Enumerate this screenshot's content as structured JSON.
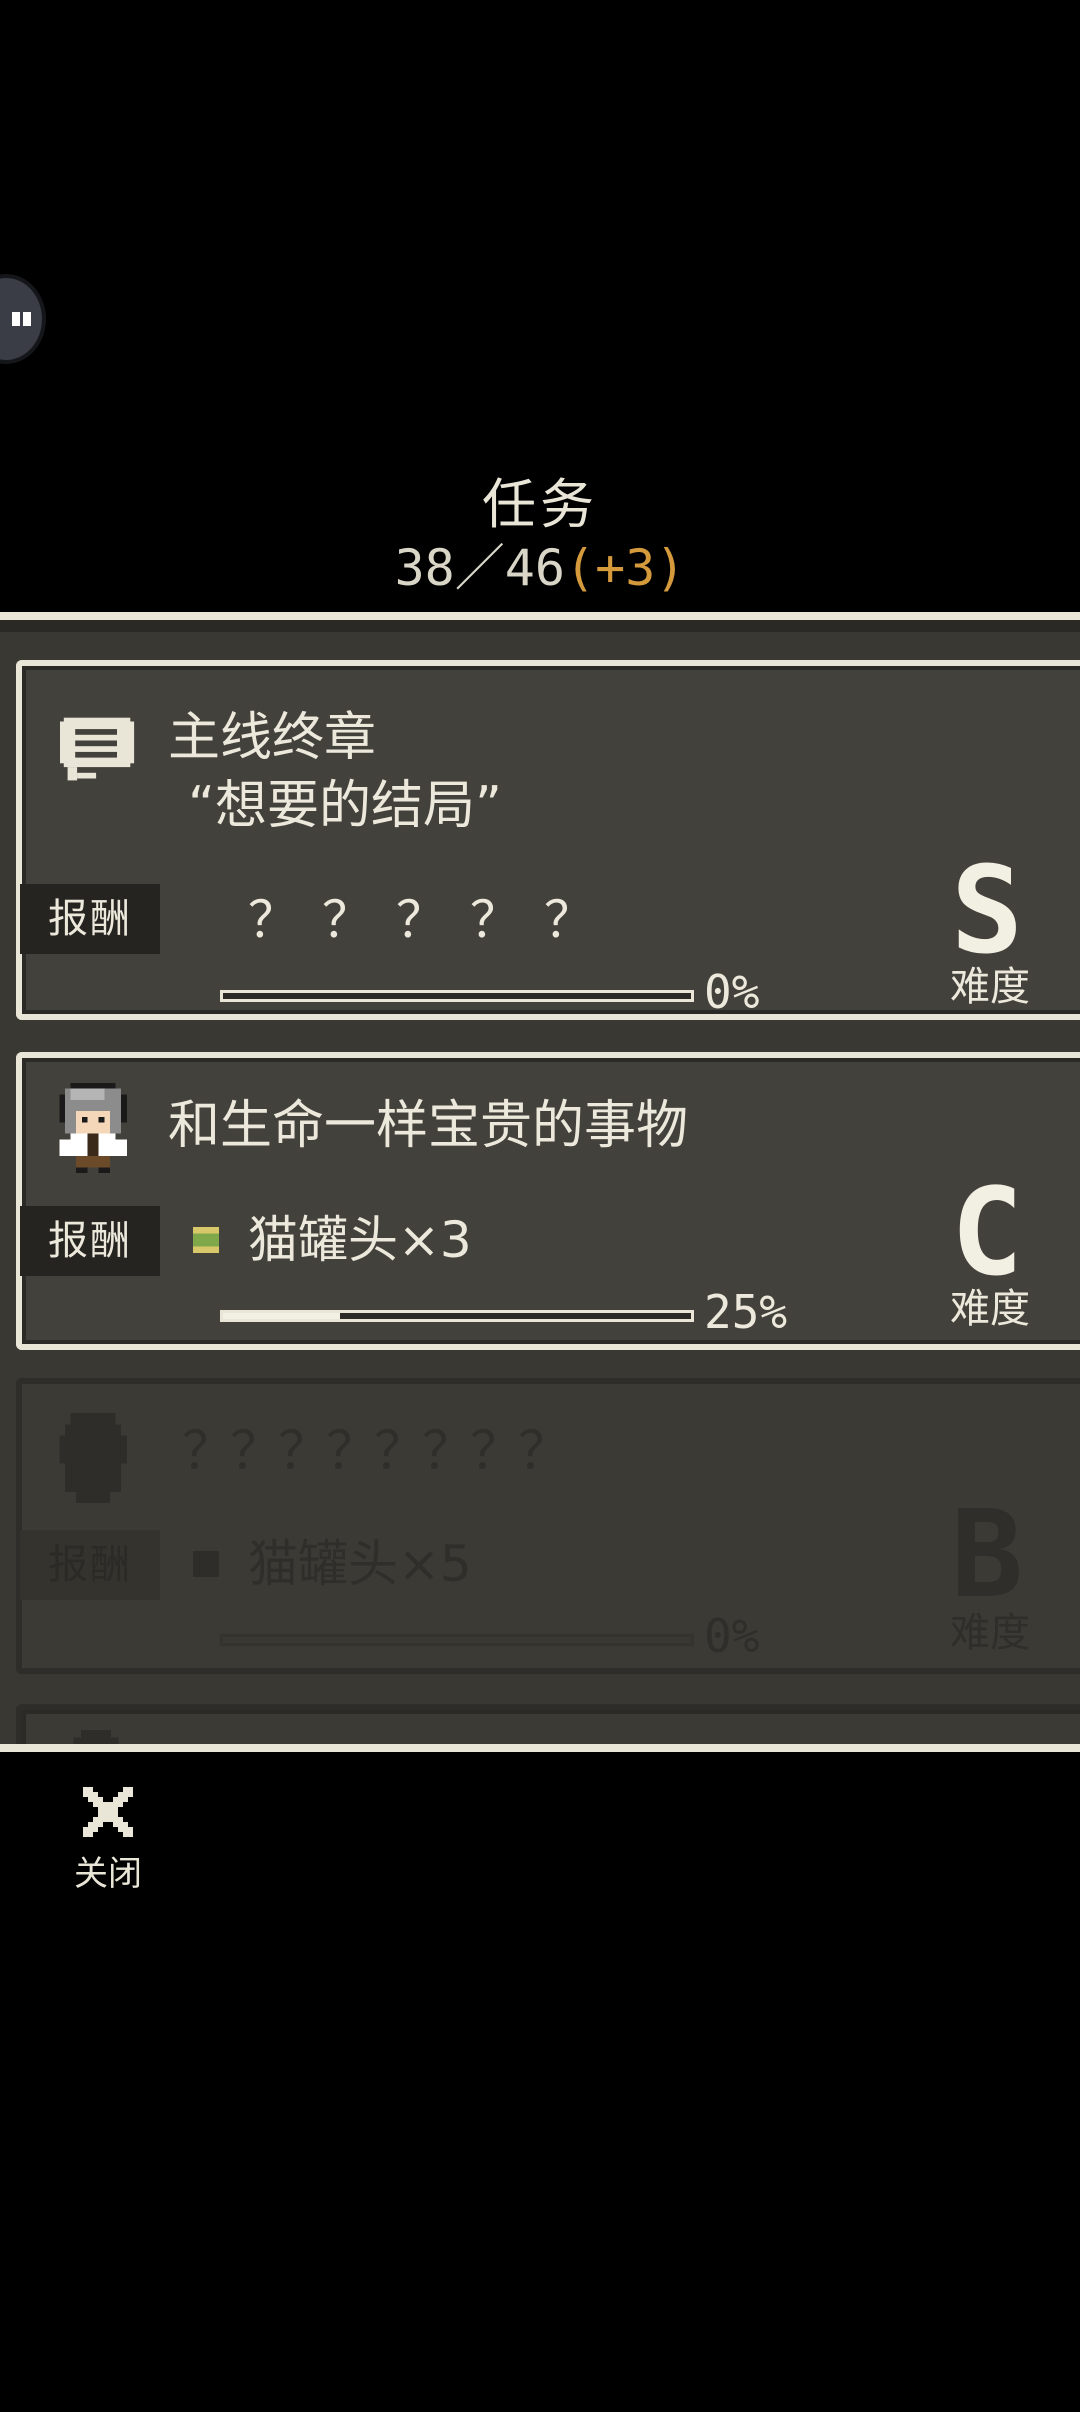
{
  "header": {
    "title": "任务",
    "progress_text": "38／46",
    "bonus_text": "(+3)"
  },
  "quests": [
    {
      "title": "主线终章",
      "subtitle": "“想要的结局”",
      "reward_label": "报酬",
      "reward": "？？？？？",
      "progress": 0,
      "percent_text": "0%",
      "grade": "S",
      "grade_label": "难度",
      "icon": "speech-bubble-icon",
      "locked": false
    },
    {
      "title": "和生命一样宝贵的事物",
      "reward_label": "报酬",
      "reward": "猫罐头×3",
      "progress": 0.25,
      "percent_text": "25%",
      "grade": "C",
      "grade_label": "难度",
      "icon": "grey-haired-character-icon",
      "locked": false
    },
    {
      "title": "？？？？？？？？",
      "reward_label": "报酬",
      "reward": "猫罐头×5",
      "progress": 0,
      "percent_text": "0%",
      "grade": "B",
      "grade_label": "难度",
      "icon": "silhouette-character-icon",
      "locked": true
    }
  ],
  "footer": {
    "close_label": "关闭"
  },
  "colors": {
    "background": "#000000",
    "panel": "#3a3833",
    "card": "#43413b",
    "border": "#e9e6d8",
    "bonus": "#d49a3c"
  }
}
